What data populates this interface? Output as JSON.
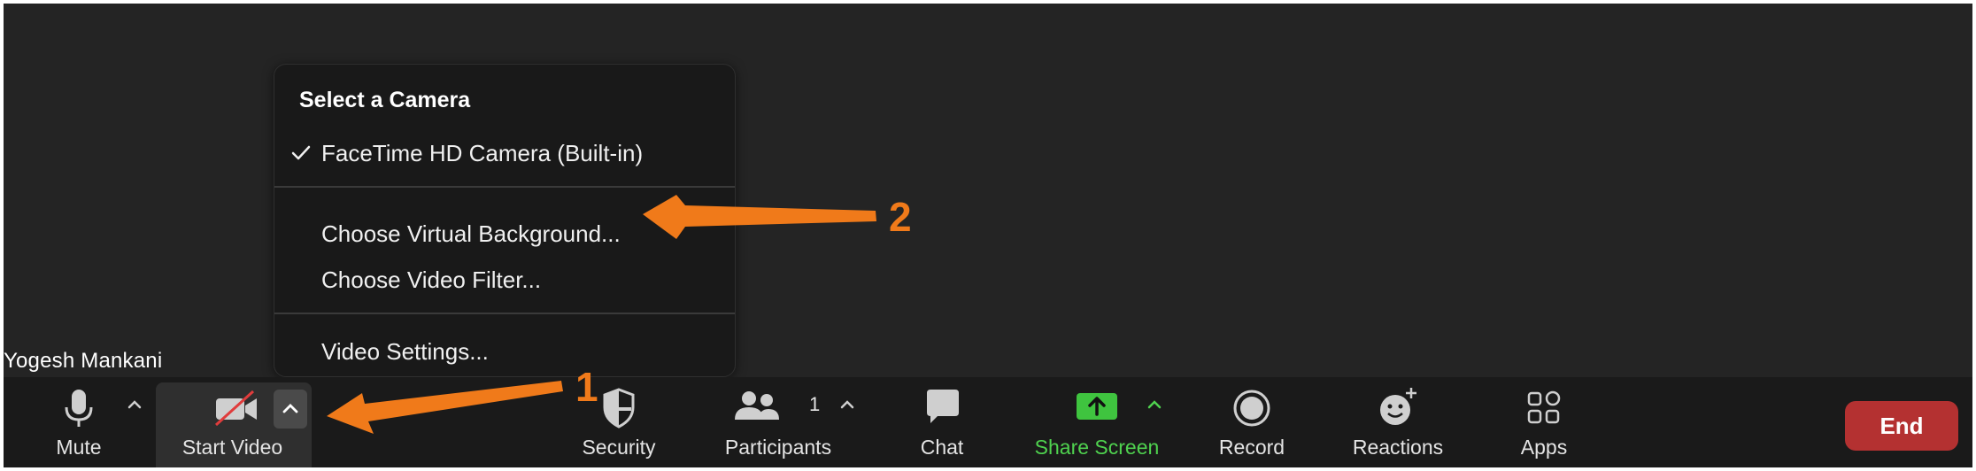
{
  "participant": {
    "name": "Yogesh Mankani"
  },
  "camera_menu": {
    "title": "Select a Camera",
    "items": [
      {
        "label": "FaceTime HD Camera (Built-in)",
        "checked": true
      },
      {
        "label": "Choose Virtual Background..."
      },
      {
        "label": "Choose Video Filter..."
      },
      {
        "label": "Video Settings..."
      }
    ]
  },
  "toolbar": {
    "mute": "Mute",
    "start_video": "Start Video",
    "security": "Security",
    "participants": "Participants",
    "participants_count": "1",
    "chat": "Chat",
    "share_screen": "Share Screen",
    "record": "Record",
    "reactions": "Reactions",
    "apps": "Apps",
    "end": "End"
  },
  "annotations": {
    "arrow_1": "1",
    "arrow_2": "2"
  },
  "colors": {
    "background": "#242424",
    "toolbar": "#1a1a1a",
    "menu": "#191919",
    "share_green": "#4fd24f",
    "end_red": "#b43131",
    "annotation_orange": "#f07a1a"
  }
}
